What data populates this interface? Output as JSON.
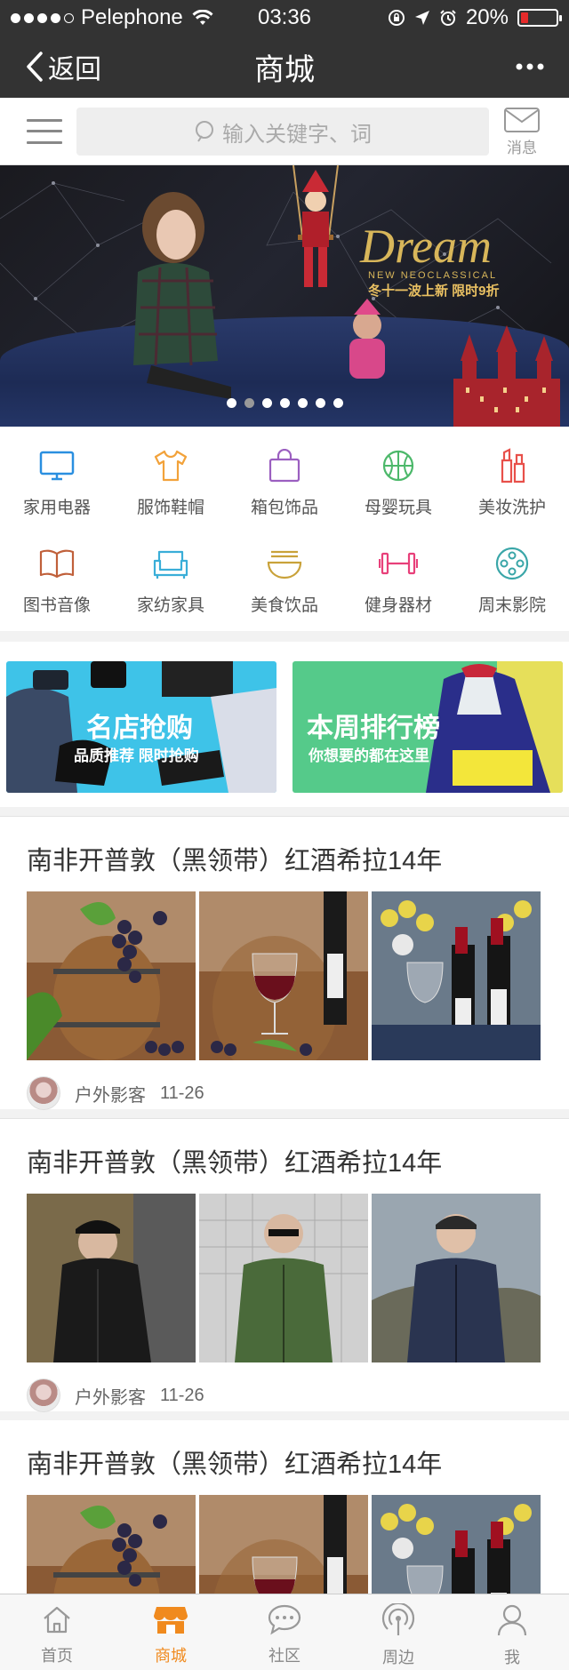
{
  "status_bar": {
    "carrier": "Pelephone",
    "time": "03:36",
    "battery": "20%",
    "battery_level": 0.2
  },
  "nav": {
    "back_label": "返回",
    "title": "商城"
  },
  "search": {
    "placeholder": "输入关键字、词",
    "message_label": "消息"
  },
  "banner": {
    "headline": "Dream",
    "subline": "NEW NEOCLASSICAL",
    "promo": "冬十一波上新 限时9折",
    "slide_count": 7,
    "active_slide": 1
  },
  "categories": [
    {
      "label": "家用电器",
      "icon": "tv-icon",
      "color": "#2a8fe0"
    },
    {
      "label": "服饰鞋帽",
      "icon": "shirt-icon",
      "color": "#f2a23a"
    },
    {
      "label": "箱包饰品",
      "icon": "bag-icon",
      "color": "#9b5fc0"
    },
    {
      "label": "母婴玩具",
      "icon": "ball-icon",
      "color": "#4cb86a"
    },
    {
      "label": "美妆洗护",
      "icon": "cosmetics-icon",
      "color": "#e8504a"
    },
    {
      "label": "图书音像",
      "icon": "book-icon",
      "color": "#c0603a"
    },
    {
      "label": "家纺家具",
      "icon": "sofa-icon",
      "color": "#3aaed8"
    },
    {
      "label": "美食饮品",
      "icon": "noodle-bowl-icon",
      "color": "#c9a23a"
    },
    {
      "label": "健身器材",
      "icon": "dumbbell-icon",
      "color": "#e8407a"
    },
    {
      "label": "周末影院",
      "icon": "film-reel-icon",
      "color": "#3aa6a8"
    }
  ],
  "promos": [
    {
      "title": "名店抢购",
      "subtitle": "品质推荐 限时抢购"
    },
    {
      "title": "本周排行榜",
      "subtitle": "你想要的都在这里"
    }
  ],
  "feed": [
    {
      "title": "南非开普敦（黑领带）红酒希拉14年",
      "author": "户外影客",
      "date": "11-26",
      "photos": [
        "wine-barrel-grapes",
        "wine-glass-bottle",
        "wine-bottles-flowers"
      ]
    },
    {
      "title": "南非开普敦（黑领带）红酒希拉14年",
      "author": "户外影客",
      "date": "11-26",
      "photos": [
        "man-black-jacket",
        "man-green-jacket",
        "man-navy-jacket"
      ]
    },
    {
      "title": "南非开普敦（黑领带）红酒希拉14年",
      "author": "",
      "date": "",
      "photos": [
        "wine-barrel-grapes",
        "wine-glass-bottle",
        "wine-bottles-flowers"
      ]
    }
  ],
  "tabs": [
    {
      "label": "首页",
      "icon": "home-icon",
      "active": false
    },
    {
      "label": "商城",
      "icon": "shop-icon",
      "active": true
    },
    {
      "label": "社区",
      "icon": "chat-bubble-icon",
      "active": false
    },
    {
      "label": "周边",
      "icon": "nearby-signal-icon",
      "active": false
    },
    {
      "label": "我",
      "icon": "user-icon",
      "active": false
    }
  ],
  "colors": {
    "header_bg": "#333333",
    "accent": "#f08a1e",
    "promo_blue": "#3ec3e8",
    "promo_green": "#55ca8a"
  }
}
